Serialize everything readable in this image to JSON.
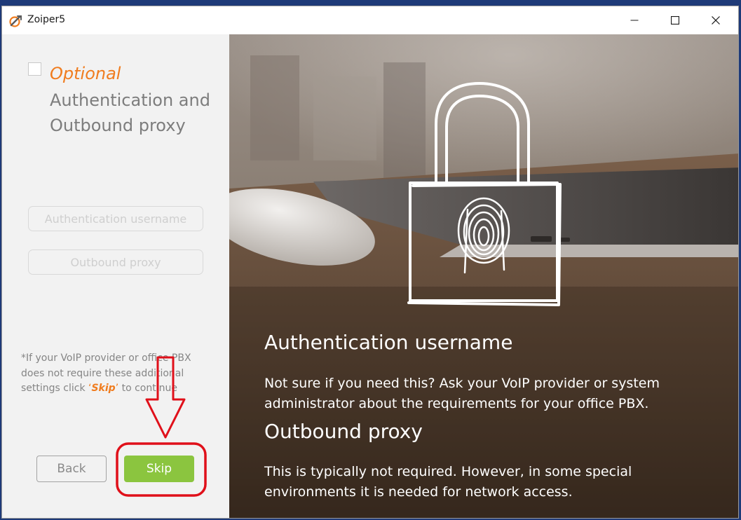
{
  "window": {
    "title": "Zoiper5",
    "minimize_label": "—",
    "maximize_label": "☐",
    "close_label": "✕"
  },
  "left_panel": {
    "optional_label": "Optional",
    "heading": "Authentication and Outbound proxy",
    "fields": {
      "auth_username_placeholder": "Authentication username",
      "outbound_proxy_placeholder": "Outbound proxy"
    },
    "note": {
      "before": "*If your VoIP provider or office PBX does not require these additional settings click ",
      "open_quote": "‘",
      "skip_word": "Skip",
      "close_quote": "’",
      "after": " to continue"
    },
    "buttons": {
      "back": "Back",
      "skip": "Skip"
    },
    "colors": {
      "accent": "#f07c1e",
      "skip_button": "#8bc53f",
      "annotation": "#e0101a"
    }
  },
  "right_panel": {
    "sections": [
      {
        "title": "Authentication username",
        "text": " Not sure if you need this? Ask your VoIP provider or system administrator about the requirements for your office PBX."
      },
      {
        "title": "Outbound proxy",
        "text": " This is typically not required. However, in some special environments it is needed for network access."
      }
    ]
  }
}
